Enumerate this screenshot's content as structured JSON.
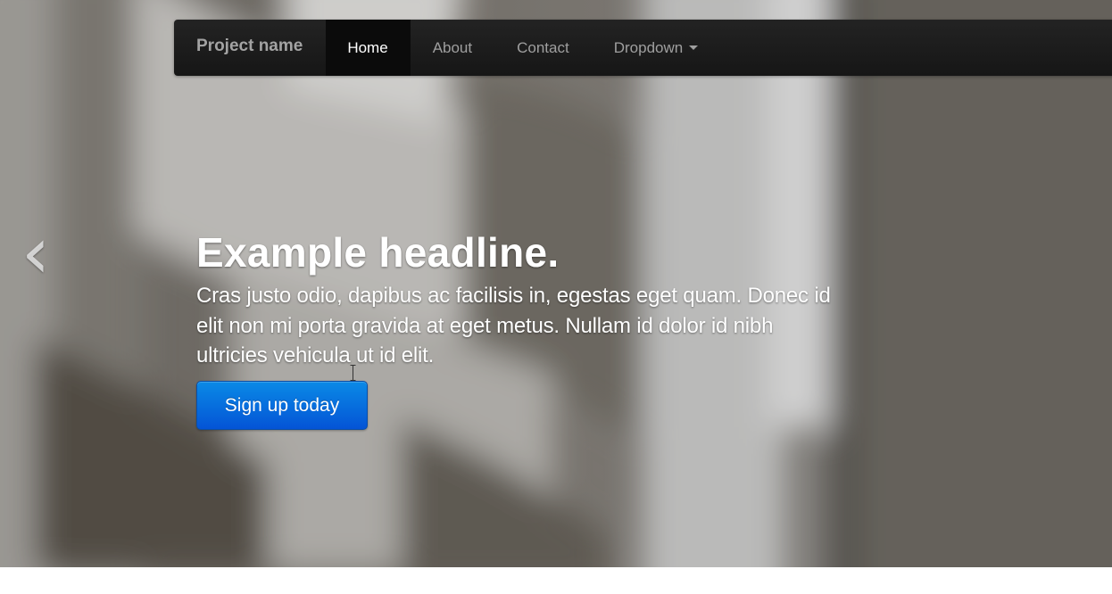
{
  "navbar": {
    "brand": "Project name",
    "items": [
      {
        "label": "Home",
        "active": true
      },
      {
        "label": "About",
        "active": false
      },
      {
        "label": "Contact",
        "active": false
      },
      {
        "label": "Dropdown",
        "active": false,
        "has_caret": true
      }
    ]
  },
  "carousel": {
    "prev_glyph": "‹",
    "caption": {
      "headline": "Example headline.",
      "body": "Cras justo odio, dapibus ac facilisis in, egestas eget quam. Donec id elit non mi porta gravida at eget metus. Nullam id dolor id nibh ultricies vehicula ut id elit.",
      "button_label": "Sign up today"
    }
  },
  "icons": {
    "prev": "chevron-left-icon",
    "dropdown": "caret-down-icon",
    "cursor": "text-cursor-icon"
  },
  "colors": {
    "navbar": "#1b1b1b",
    "nav_active": "#0b0b0b",
    "button_top": "#0a8ae6",
    "button_bottom": "#0454d6"
  }
}
